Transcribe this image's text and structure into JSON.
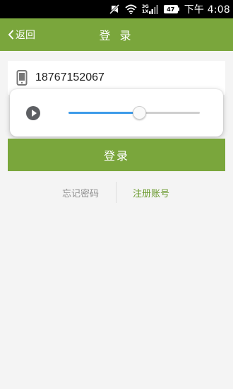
{
  "status_bar": {
    "time": "下午 4:08",
    "network_type": "3G",
    "network_sub": "1X",
    "battery_level": "47",
    "icons": [
      "muted-notification-icon",
      "wifi-icon",
      "signal-icon",
      "battery-icon"
    ]
  },
  "header": {
    "back_label": "返回",
    "title": "登 录",
    "color": "#7aa63c"
  },
  "form": {
    "phone_icon": "phone-icon",
    "phone_value": "18767152067"
  },
  "audio_player": {
    "play_icon": "play-icon",
    "progress": 0.54,
    "fill_color": "#3d9be9"
  },
  "login_button": {
    "label": "登录"
  },
  "links": {
    "forgot_password": "忘记密码",
    "register": "注册账号",
    "register_color": "#6b9a2e"
  }
}
